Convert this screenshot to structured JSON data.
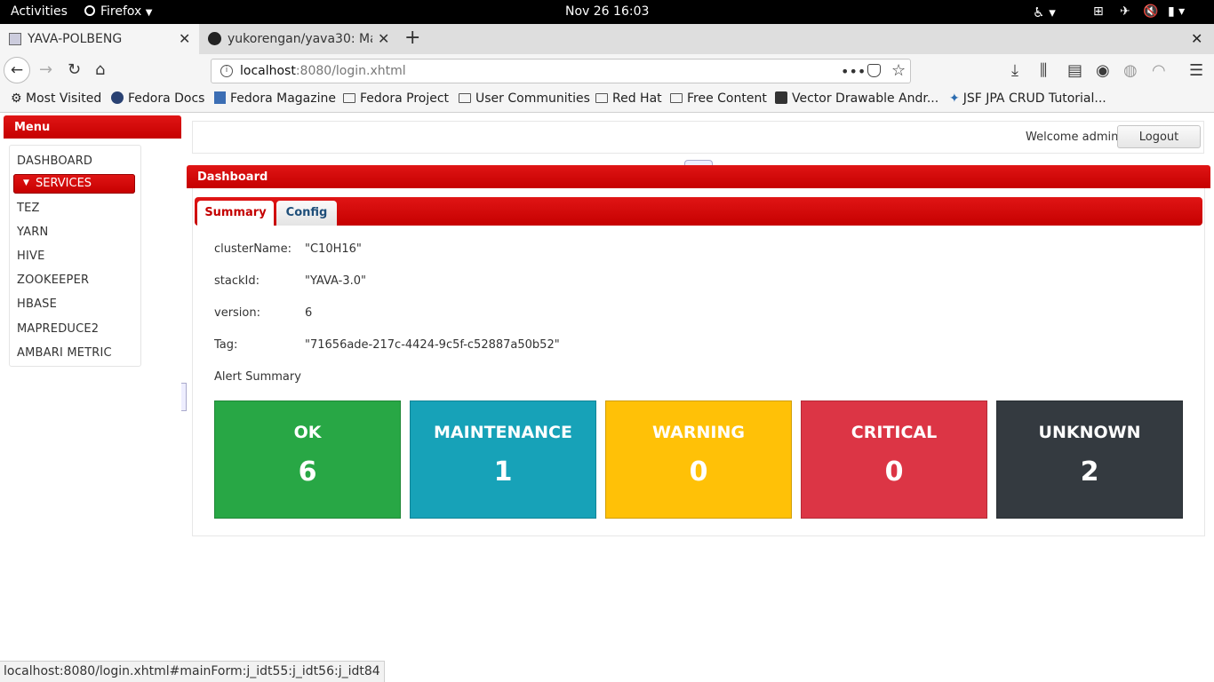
{
  "system": {
    "activities": "Activities",
    "app_name": "Firefox",
    "clock": "Nov 26  16:03"
  },
  "browser": {
    "tabs": [
      {
        "title": "YAVA-POLBENG",
        "active": true
      },
      {
        "title": "yukorengan/yava30: Mag",
        "active": false
      }
    ],
    "url_host": "localhost",
    "url_rest": ":8080/login.xhtml",
    "bookmarks": [
      "Most Visited",
      "Fedora Docs",
      "Fedora Magazine",
      "Fedora Project",
      "User Communities",
      "Red Hat",
      "Free Content",
      "Vector Drawable Andr...",
      "JSF JPA CRUD Tutorial..."
    ],
    "status_url": "localhost:8080/login.xhtml#mainForm:j_idt55:j_idt56:j_idt84"
  },
  "page": {
    "menu_title": "Menu",
    "menu_items": {
      "dashboard": "DASHBOARD",
      "services": "SERVICES",
      "tez": "TEZ",
      "yarn": "YARN",
      "hive": "HIVE",
      "zookeeper": "ZOOKEEPER",
      "hbase": "HBASE",
      "mapreduce2": "MAPREDUCE2",
      "ambari_metric": "AMBARI METRIC"
    },
    "welcome": "Welcome admin",
    "logout_label": "Logout",
    "dashboard_title": "Dashboard",
    "tabs": {
      "summary": "Summary",
      "config": "Config"
    },
    "fields": [
      {
        "key": "clusterName:",
        "value": "\"C10H16\""
      },
      {
        "key": "stackId:",
        "value": "\"YAVA-3.0\""
      },
      {
        "key": "version:",
        "value": "6"
      },
      {
        "key": "Tag:",
        "value": "\"71656ade-217c-4424-9c5f-c52887a50b52\""
      }
    ],
    "alert_summary_label": "Alert Summary",
    "alerts": [
      {
        "title": "OK",
        "count": "6",
        "color": "#28a745"
      },
      {
        "title": "MAINTENANCE",
        "count": "1",
        "color": "#17a2b8"
      },
      {
        "title": "WARNING",
        "count": "0",
        "color": "#ffc107"
      },
      {
        "title": "CRITICAL",
        "count": "0",
        "color": "#dc3545"
      },
      {
        "title": "UNKNOWN",
        "count": "2",
        "color": "#343a40"
      }
    ]
  }
}
